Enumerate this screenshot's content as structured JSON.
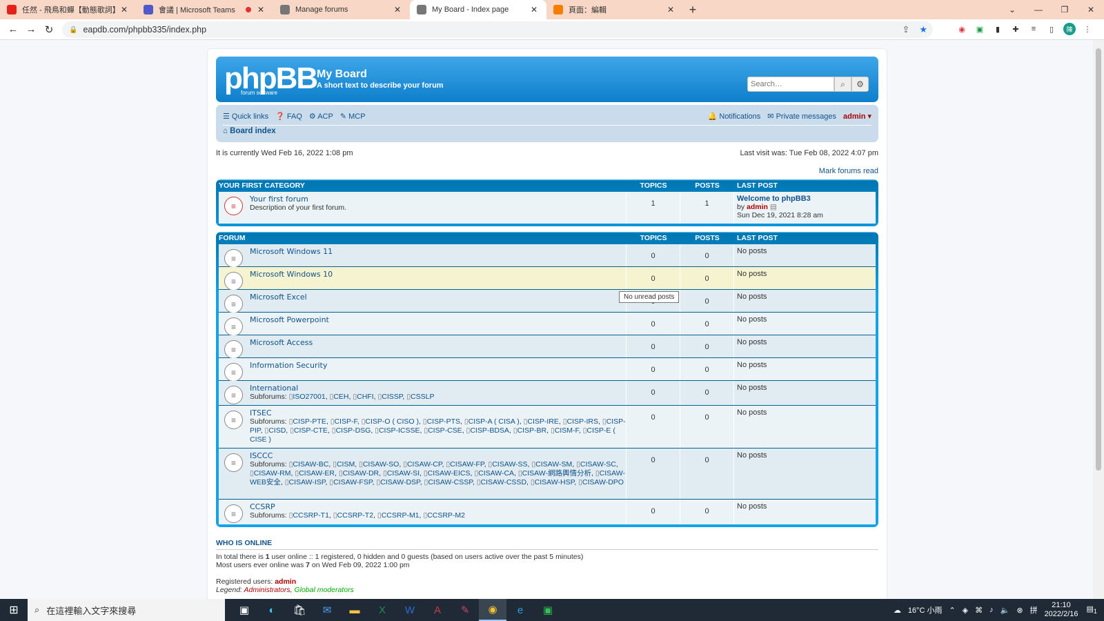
{
  "browser": {
    "tabs": [
      {
        "label": "任然 - 飛鳥和蟬【動態歌詞】「",
        "icon": "youtube-icon",
        "color": "#e62117",
        "recording": false
      },
      {
        "label": "會議 | Microsoft Teams",
        "icon": "teams-icon",
        "color": "#5059c9",
        "recording": true
      },
      {
        "label": "Manage forums",
        "icon": "globe-icon",
        "color": "#777777",
        "recording": false
      },
      {
        "label": "My Board - Index page",
        "icon": "globe-icon",
        "color": "#777777",
        "recording": false,
        "active": true
      },
      {
        "label": "頁面：編輯",
        "icon": "blogger-icon",
        "color": "#f57d00",
        "recording": false
      }
    ],
    "url": "eapdb.com/phpbb335/index.php"
  },
  "board": {
    "name": "My Board",
    "description": "A short text to describe your forum",
    "logo_text": "phpBB",
    "logo_sub": "forum     software",
    "search_placeholder": "Search…",
    "nav": {
      "quick_links": "Quick links",
      "faq": "FAQ",
      "acp": "ACP",
      "mcp": "MCP",
      "notifications": "Notifications",
      "private_messages": "Private messages",
      "user": "admin"
    },
    "breadcrumb": "Board index",
    "current_time": "It is currently Wed Feb 16, 2022 1:08 pm",
    "last_visit": "Last visit was: Tue Feb 08, 2022 4:07 pm",
    "mark_read": "Mark forums read"
  },
  "category1": {
    "title": "Your first category",
    "col_topics": "Topics",
    "col_posts": "Posts",
    "col_last": "Last post",
    "forum": {
      "title": "Your first forum",
      "desc": "Description of your first forum.",
      "topics": "1",
      "posts": "1",
      "last_title": "Welcome to phpBB3",
      "last_by": "by",
      "last_user": "admin",
      "last_date": "Sun Dec 19, 2021 8:28 am"
    }
  },
  "category2": {
    "title": "Forum",
    "col_topics": "Topics",
    "col_posts": "Posts",
    "col_last": "Last post",
    "tooltip": "No unread posts",
    "forums": [
      {
        "title": "Microsoft Windows 11",
        "topics": "0",
        "posts": "0",
        "last": "No posts"
      },
      {
        "title": "Microsoft Windows 10",
        "topics": "0",
        "posts": "0",
        "last": "No posts"
      },
      {
        "title": "Microsoft Excel",
        "topics": "0",
        "posts": "0",
        "last": "No posts"
      },
      {
        "title": "Microsoft Powerpoint",
        "topics": "0",
        "posts": "0",
        "last": "No posts"
      },
      {
        "title": "Microsoft Access",
        "topics": "0",
        "posts": "0",
        "last": "No posts"
      },
      {
        "title": "Information Security",
        "topics": "0",
        "posts": "0",
        "last": "No posts"
      },
      {
        "title": "International",
        "topics": "0",
        "posts": "0",
        "last": "No posts",
        "subforums": [
          "ISO27001",
          "CEH",
          "CHFI",
          "CISSP",
          "CSSLP"
        ]
      },
      {
        "title": "ITSEC",
        "topics": "0",
        "posts": "0",
        "last": "No posts",
        "subforums": [
          "CISP-PTE",
          "CISP-F",
          "CISP-O ( CISO )",
          "CISP-PTS",
          "CISP-A ( CISA )",
          "CISP-IRE",
          "CISP-IRS",
          "CISP-PIP",
          "CISD",
          "CISP-CTE",
          "CISP-DSG",
          "CISP-ICSSE",
          "CISP-CSE",
          "CISP-BDSA",
          "CISP-BR",
          "CISM-F",
          "CISP-E ( CISE )"
        ]
      },
      {
        "title": "ISCCC",
        "topics": "0",
        "posts": "0",
        "last": "No posts",
        "subforums": [
          "CISAW-BC",
          "CISM",
          "CISAW-SO",
          "CISAW-CP",
          "CISAW-FP",
          "CISAW-SS",
          "CISAW-SM",
          "CISAW-SC",
          "CISAW-RM",
          "CISAW-ER",
          "CISAW-DR",
          "CISAW-SI",
          "CISAW-EICS",
          "CISAW-CA",
          "CISAW-網路輿情分析",
          "CISAW-WEB安全",
          "CISAW-ISP",
          "CISAW-FSP",
          "CISAW-DSP",
          "CISAW-CSSP",
          "CISAW-CSSD",
          "CISAW-HSP",
          "CISAW-DPO"
        ]
      },
      {
        "title": "CCSRP",
        "topics": "0",
        "posts": "0",
        "last": "No posts",
        "subforums": [
          "CCSRP-T1",
          "CCSRP-T2",
          "CCSRP-M1",
          "CCSRP-M2"
        ]
      }
    ],
    "subforums_label": "Subforums:"
  },
  "online": {
    "title": "Who is online",
    "line1_pre": "In total there is ",
    "line1_num": "1",
    "line1_post": " user online :: 1 registered, 0 hidden and 0 guests (based on users active over the past 5 minutes)",
    "line2_pre": "Most users ever online was ",
    "line2_num": "7",
    "line2_post": " on Wed Feb 09, 2022 1:00 pm",
    "registered_label": "Registered users: ",
    "registered_user": "admin",
    "legend_label": "Legend: ",
    "legend_admins": "Administrators",
    "legend_sep": ", ",
    "legend_mods": "Global moderators"
  },
  "taskbar": {
    "search_placeholder": "在這裡輸入文字來搜尋",
    "weather": "16°C 小雨",
    "time": "21:10",
    "date": "2022/2/16",
    "notif_count": "1"
  }
}
